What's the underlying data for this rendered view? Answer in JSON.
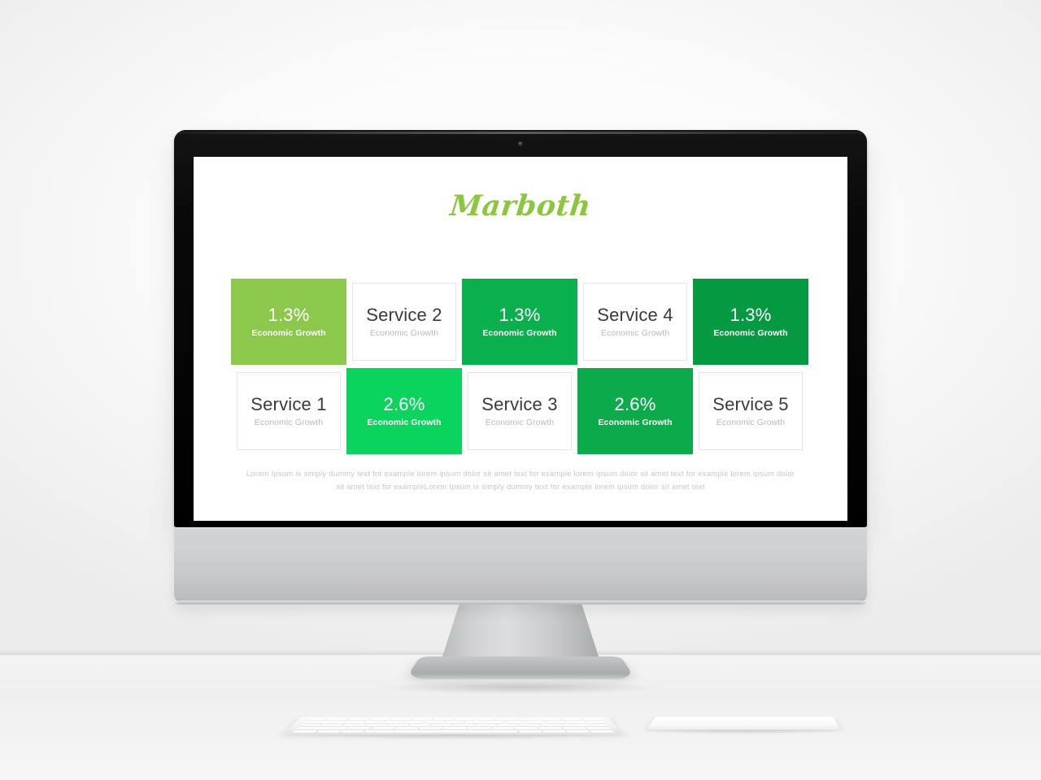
{
  "slide": {
    "logo": "Marboth",
    "logo_color": "#8cc63f",
    "background_color": "#ffffff",
    "body_text": "Lorem Ipsum is simply dummy  text for example lorem  ipsum dolor  sit amet text for example lorem ipsum dolor  sit amet text for example lorem ipsum dolor  sit amet text for exampleLorem  Ipsum is simply dummy  text for example lorem  ipsum dolor  sit amet text",
    "cards": [
      {
        "value": "1.3%",
        "sub": "Economic Growth",
        "style": "filled",
        "color": "#8cc84b",
        "row": 1,
        "col": 1
      },
      {
        "value": "Service 2",
        "sub": "Economic Growth",
        "style": "plain",
        "color": "#ffffff",
        "row": 1,
        "col": 2
      },
      {
        "value": "1.3%",
        "sub": "Economic Growth",
        "style": "filled",
        "color": "#0bb04e",
        "row": 1,
        "col": 3
      },
      {
        "value": "Service 4",
        "sub": "Economic Growth",
        "style": "plain",
        "color": "#ffffff",
        "row": 1,
        "col": 4
      },
      {
        "value": "1.3%",
        "sub": "Economic Growth",
        "style": "filled",
        "color": "#059a41",
        "row": 1,
        "col": 5
      },
      {
        "value": "Service 1",
        "sub": "Economic Growth",
        "style": "plain",
        "color": "#ffffff",
        "row": 2,
        "col": 1
      },
      {
        "value": "2.6%",
        "sub": "Economic Growth",
        "style": "filled",
        "color": "#0bd45e",
        "row": 2,
        "col": 2
      },
      {
        "value": "Service 3",
        "sub": "Economic Growth",
        "style": "plain",
        "color": "#ffffff",
        "row": 2,
        "col": 3
      },
      {
        "value": "2.6%",
        "sub": "Economic Growth",
        "style": "filled",
        "color": "#0bab4b",
        "row": 2,
        "col": 4
      },
      {
        "value": "Service 5",
        "sub": "Economic Growth",
        "style": "plain",
        "color": "#ffffff",
        "row": 2,
        "col": 5
      }
    ]
  },
  "device": {
    "type": "desktop-monitor",
    "bezel_color": "#050505",
    "chin_color": "#c6c8c9",
    "peripherals": [
      "keyboard",
      "trackpad"
    ]
  }
}
